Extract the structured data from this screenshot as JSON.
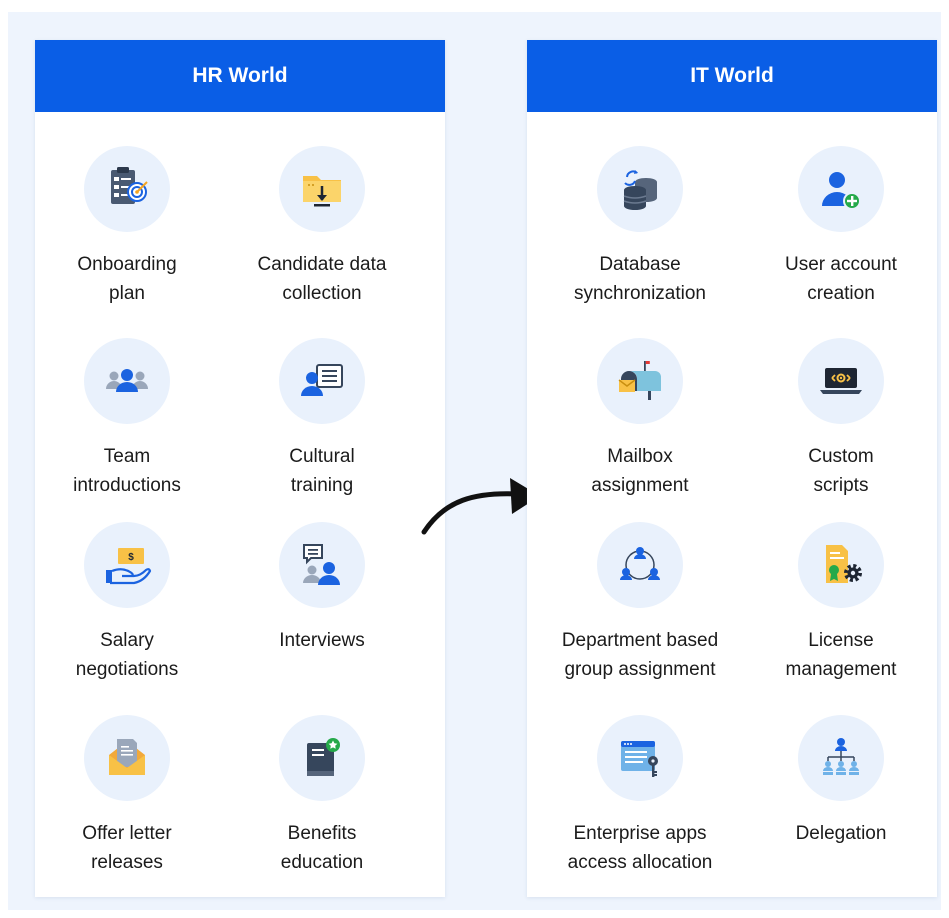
{
  "colors": {
    "header_bg": "#0a5ee6",
    "canvas_bg": "#eef4fd",
    "icon_bg": "#e9f1fc",
    "icon_dark": "#36465c",
    "icon_blue": "#1b63e0",
    "icon_yellow": "#f8c146",
    "icon_green": "#25a94a"
  },
  "hr_panel": {
    "title": "HR World",
    "items": [
      {
        "line1": "Onboarding",
        "line2": "plan",
        "icon": "checklist-target-icon"
      },
      {
        "line1": "Candidate data",
        "line2": "collection",
        "icon": "folder-download-icon"
      },
      {
        "line1": "Team",
        "line2": "introductions",
        "icon": "team-icon"
      },
      {
        "line1": "Cultural",
        "line2": "training",
        "icon": "presentation-icon"
      },
      {
        "line1": "Salary",
        "line2": "negotiations",
        "icon": "money-hand-icon"
      },
      {
        "line1": "Interviews",
        "line2": "",
        "icon": "interview-chat-icon"
      },
      {
        "line1": "Offer letter",
        "line2": "releases",
        "icon": "envelope-letter-icon"
      },
      {
        "line1": "Benefits",
        "line2": "education",
        "icon": "book-badge-icon"
      }
    ]
  },
  "it_panel": {
    "title": "IT World",
    "items": [
      {
        "line1": "Database",
        "line2": "synchronization",
        "icon": "database-sync-icon"
      },
      {
        "line1": "User account",
        "line2": "creation",
        "icon": "user-add-icon"
      },
      {
        "line1": "Mailbox",
        "line2": "assignment",
        "icon": "mailbox-icon"
      },
      {
        "line1": "Custom",
        "line2": "scripts",
        "icon": "laptop-code-icon"
      },
      {
        "line1": "Department based",
        "line2": "group assignment",
        "icon": "group-cycle-icon"
      },
      {
        "line1": "License",
        "line2": "management",
        "icon": "license-gear-icon"
      },
      {
        "line1": "Enterprise apps",
        "line2": "access allocation",
        "icon": "browser-key-icon"
      },
      {
        "line1": "Delegation",
        "line2": "",
        "icon": "hierarchy-icon"
      }
    ]
  }
}
